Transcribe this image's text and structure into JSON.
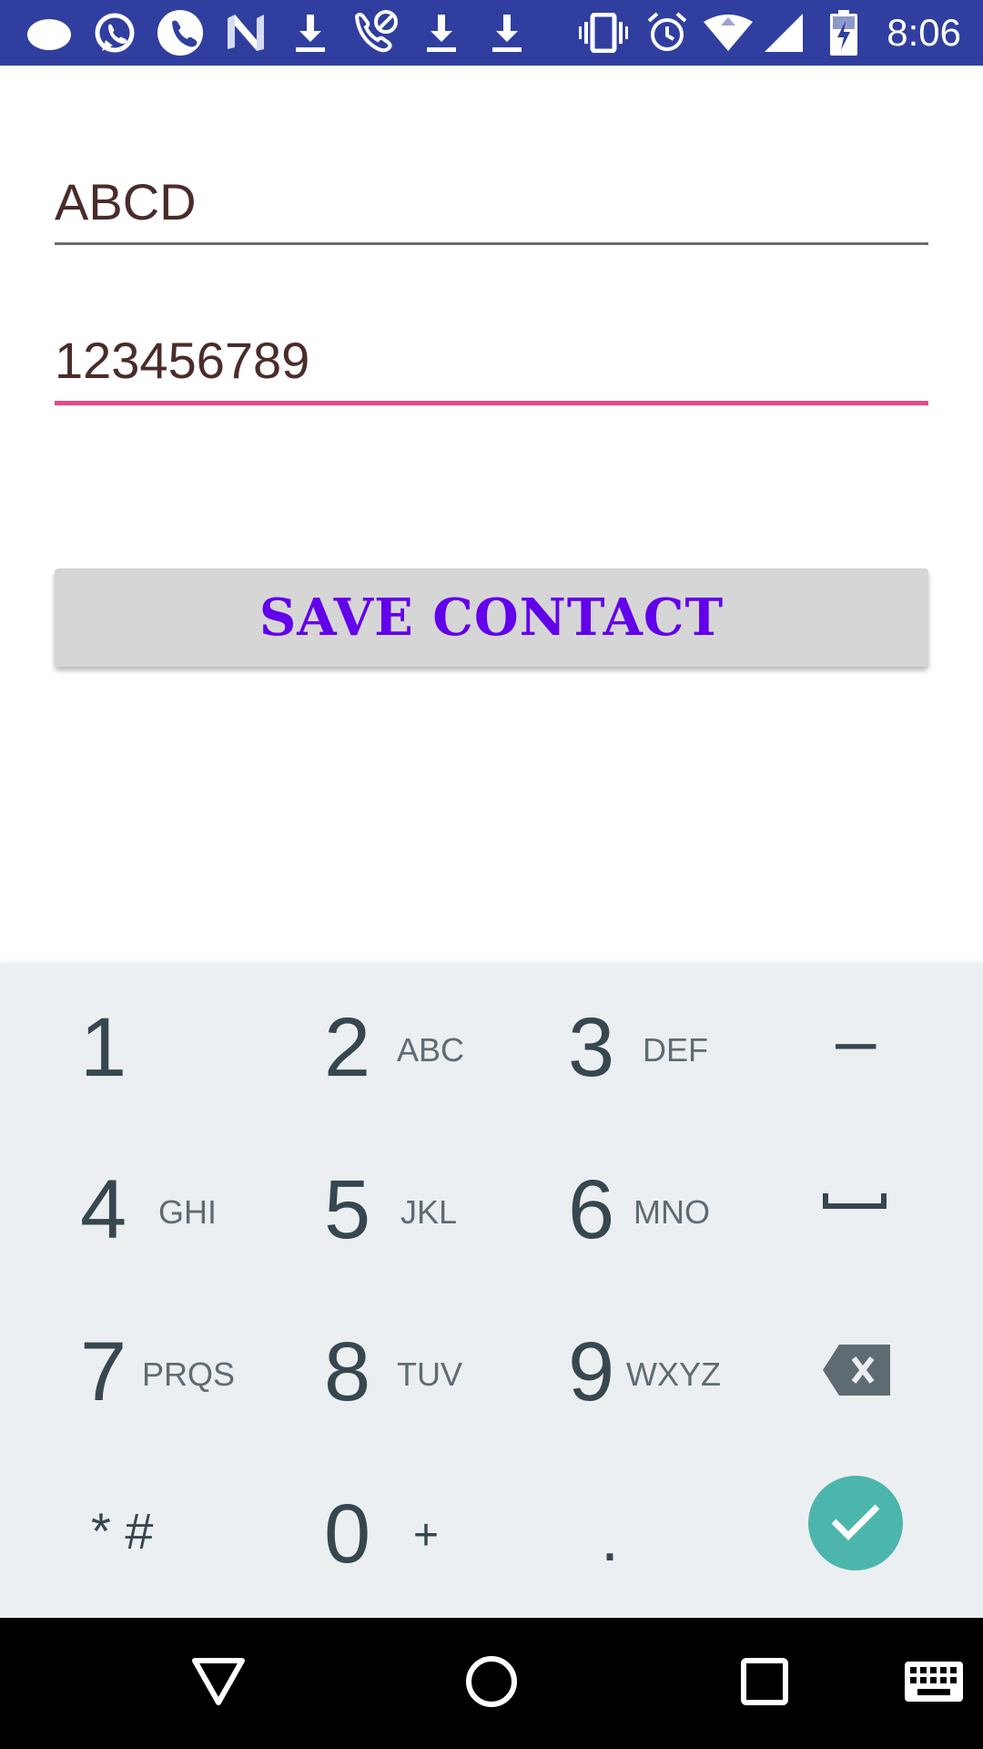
{
  "status_bar": {
    "time": "8:06",
    "icons": [
      "cloud-icon",
      "whatsapp-icon",
      "phone-icon",
      "n-app-icon",
      "download-icon",
      "missed-call-icon",
      "download-icon",
      "download-icon",
      "vibrate-icon",
      "alarm-icon",
      "wifi-icon",
      "signal-icon",
      "battery-charging-icon"
    ],
    "background": "#303f9f"
  },
  "form": {
    "name_value": "ABCD",
    "phone_value": "123456789",
    "save_label": "SAVE CONTACT",
    "accent_color": "#e64a86",
    "button_text_color": "#6200ea"
  },
  "keypad": {
    "keys": [
      {
        "digit": "1",
        "letters": ""
      },
      {
        "digit": "2",
        "letters": "ABC"
      },
      {
        "digit": "3",
        "letters": "DEF"
      },
      {
        "digit": "4",
        "letters": "GHI"
      },
      {
        "digit": "5",
        "letters": "JKL"
      },
      {
        "digit": "6",
        "letters": "MNO"
      },
      {
        "digit": "7",
        "letters": "PRQS"
      },
      {
        "digit": "8",
        "letters": "TUV"
      },
      {
        "digit": "9",
        "letters": "WXYZ"
      },
      {
        "digit": "0",
        "letters": "+"
      }
    ],
    "minus": "–",
    "star_hash": "* #",
    "dot": ".",
    "space_icon": "space-icon",
    "backspace_icon": "backspace-icon",
    "done_icon": "check-icon",
    "done_color": "#4db6ac"
  },
  "nav_bar": {
    "buttons": [
      "back-icon",
      "home-icon",
      "recents-icon",
      "keyboard-icon"
    ]
  }
}
